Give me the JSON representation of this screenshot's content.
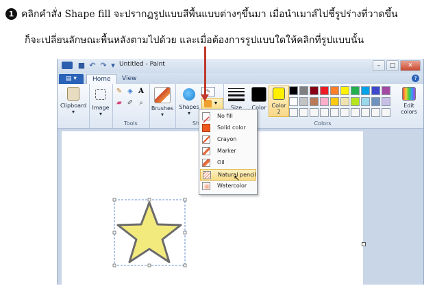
{
  "instructions": {
    "step_number": "1",
    "line1": "คลิกคำสั่ง Shape fill  จะปรากฏรูปแบบสีพื้นแบบต่างๆขึ้นมา เมื่อนำเมาส์ไปชี้รูปร่างที่วาดขึ้น",
    "line2": "ก็จะเปลี่ยนลักษณะพื้นหลังตามไปด้วย และเมื่อต้องการรูปแบบใดให้คลิกที่รูปแบบนั้น"
  },
  "window": {
    "title": "Untitled - Paint"
  },
  "tabs": {
    "home": "Home",
    "view": "View",
    "help": "?"
  },
  "ribbon": {
    "clipboard": "Clipboard",
    "image": "Image",
    "tools_group": "Tools",
    "brushes": "Brushes",
    "shapes": "Shapes",
    "shapes_group": "Shap",
    "size": "Size",
    "color1": "Color",
    "color2_line1": "Color",
    "color2_line2": "2",
    "edit_colors_line1": "Edit",
    "edit_colors_line2": "colors",
    "colors_group": "Colors",
    "text_tool": "A"
  },
  "palette": {
    "row1": [
      "#000000",
      "#7f7f7f",
      "#880015",
      "#ed1c24",
      "#ff7f27",
      "#fff200",
      "#22b14c",
      "#00a2e8",
      "#3f48cc",
      "#a349a4"
    ],
    "row2": [
      "#ffffff",
      "#c3c3c3",
      "#b97a57",
      "#ffaec9",
      "#ffc90e",
      "#efe4b0",
      "#b5e61d",
      "#99d9ea",
      "#7092be",
      "#c8bfe7"
    ],
    "color1_value": "#000000",
    "color2_value": "#ffef00",
    "accent": "#c0392b"
  },
  "shape_fill_menu": {
    "items": [
      {
        "label": "No fill",
        "icon": "no-fill-icon"
      },
      {
        "label": "Solid color",
        "icon": "solid-color-icon"
      },
      {
        "label": "Crayon",
        "icon": "crayon-icon"
      },
      {
        "label": "Marker",
        "icon": "marker-icon"
      },
      {
        "label": "Oil",
        "icon": "oil-icon"
      },
      {
        "label": "Natural pencil",
        "icon": "natural-pencil-icon"
      },
      {
        "label": "Watercolor",
        "icon": "watercolor-icon"
      }
    ],
    "hovered": "Natural pencil"
  }
}
